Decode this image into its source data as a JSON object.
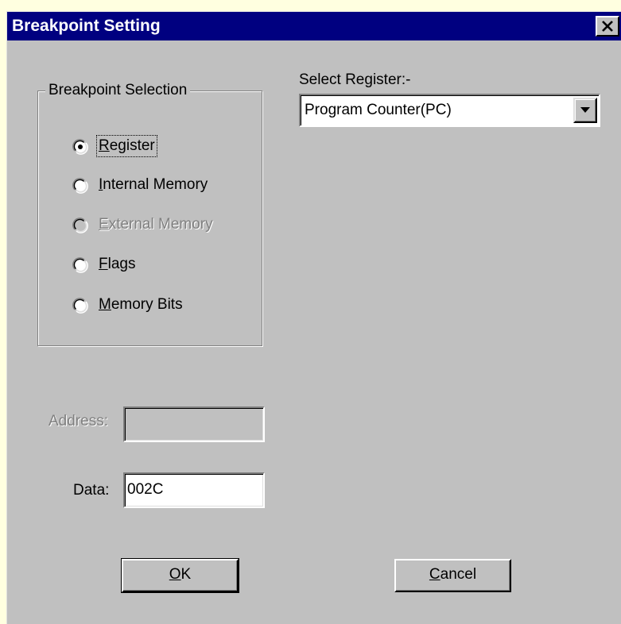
{
  "window": {
    "title": "Breakpoint Setting",
    "close_glyph": "×"
  },
  "group": {
    "legend": "Breakpoint Selection",
    "options": [
      {
        "mnemonic": "R",
        "rest": "egister",
        "selected": true,
        "disabled": false
      },
      {
        "mnemonic": "I",
        "rest": "nternal Memory",
        "selected": false,
        "disabled": false
      },
      {
        "mnemonic": "E",
        "rest": "xternal Memory",
        "selected": false,
        "disabled": true
      },
      {
        "mnemonic": "F",
        "rest": "lags",
        "selected": false,
        "disabled": false
      },
      {
        "mnemonic": "M",
        "rest": "emory Bits",
        "selected": false,
        "disabled": false
      }
    ]
  },
  "register": {
    "label": "Select Register:-",
    "selected": "Program Counter(PC)"
  },
  "address": {
    "label": "Address:",
    "value": ""
  },
  "data": {
    "label": "Data:",
    "value": "002C"
  },
  "buttons": {
    "ok_mnemonic": "O",
    "ok_rest": "K",
    "cancel_mnemonic": "C",
    "cancel_rest": "ancel"
  },
  "colors": {
    "title_bar": "#000080",
    "face": "#c0c0c0",
    "desktop": "#ffffe0",
    "disabled_text": "#808080"
  }
}
